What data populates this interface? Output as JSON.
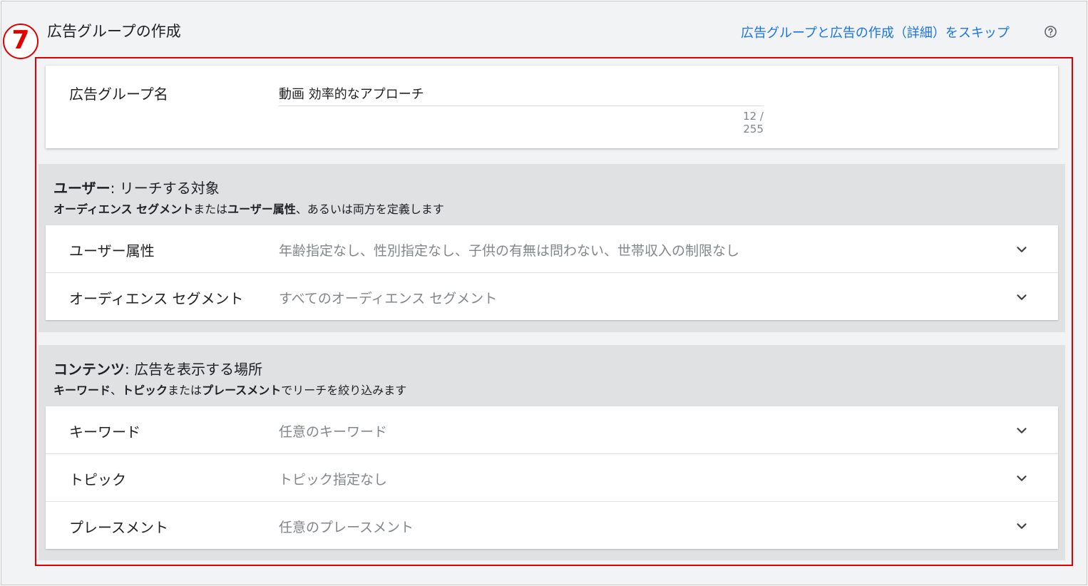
{
  "annotation": {
    "number": "7"
  },
  "header": {
    "title": "広告グループの作成",
    "skip_link": "広告グループと広告の作成（詳細）をスキップ"
  },
  "ad_group_name": {
    "label": "広告グループ名",
    "value": "動画 効率的なアプローチ",
    "char_count": "12 / 255"
  },
  "users_section": {
    "title_bold": "ユーザー",
    "title_rest": ": リーチする対象",
    "desc_bold1": "オーディエンス セグメント",
    "desc_mid": "または",
    "desc_bold2": "ユーザー属性",
    "desc_rest": "、あるいは両方を定義します",
    "rows": [
      {
        "label": "ユーザー属性",
        "value": "年齢指定なし、性別指定なし、子供の有無は問わない、世帯収入の制限なし"
      },
      {
        "label": "オーディエンス セグメント",
        "value": "すべてのオーディエンス セグメント"
      }
    ]
  },
  "content_section": {
    "title_bold": "コンテンツ",
    "title_rest": ": 広告を表示する場所",
    "desc_bold1": "キーワード",
    "desc_sep": "、",
    "desc_bold2": "トピック",
    "desc_mid": "または",
    "desc_bold3": "プレースメント",
    "desc_rest": "でリーチを絞り込みます",
    "rows": [
      {
        "label": "キーワード",
        "value": "任意のキーワード"
      },
      {
        "label": "トピック",
        "value": "トピック指定なし"
      },
      {
        "label": "プレースメント",
        "value": "任意のプレースメント"
      }
    ]
  },
  "colors": {
    "accent": "#1a73e8",
    "annotation": "#e00000",
    "section_bg": "#e0e1e3"
  },
  "icons": {
    "help": "help-circle-icon",
    "expand": "chevron-down-icon"
  }
}
